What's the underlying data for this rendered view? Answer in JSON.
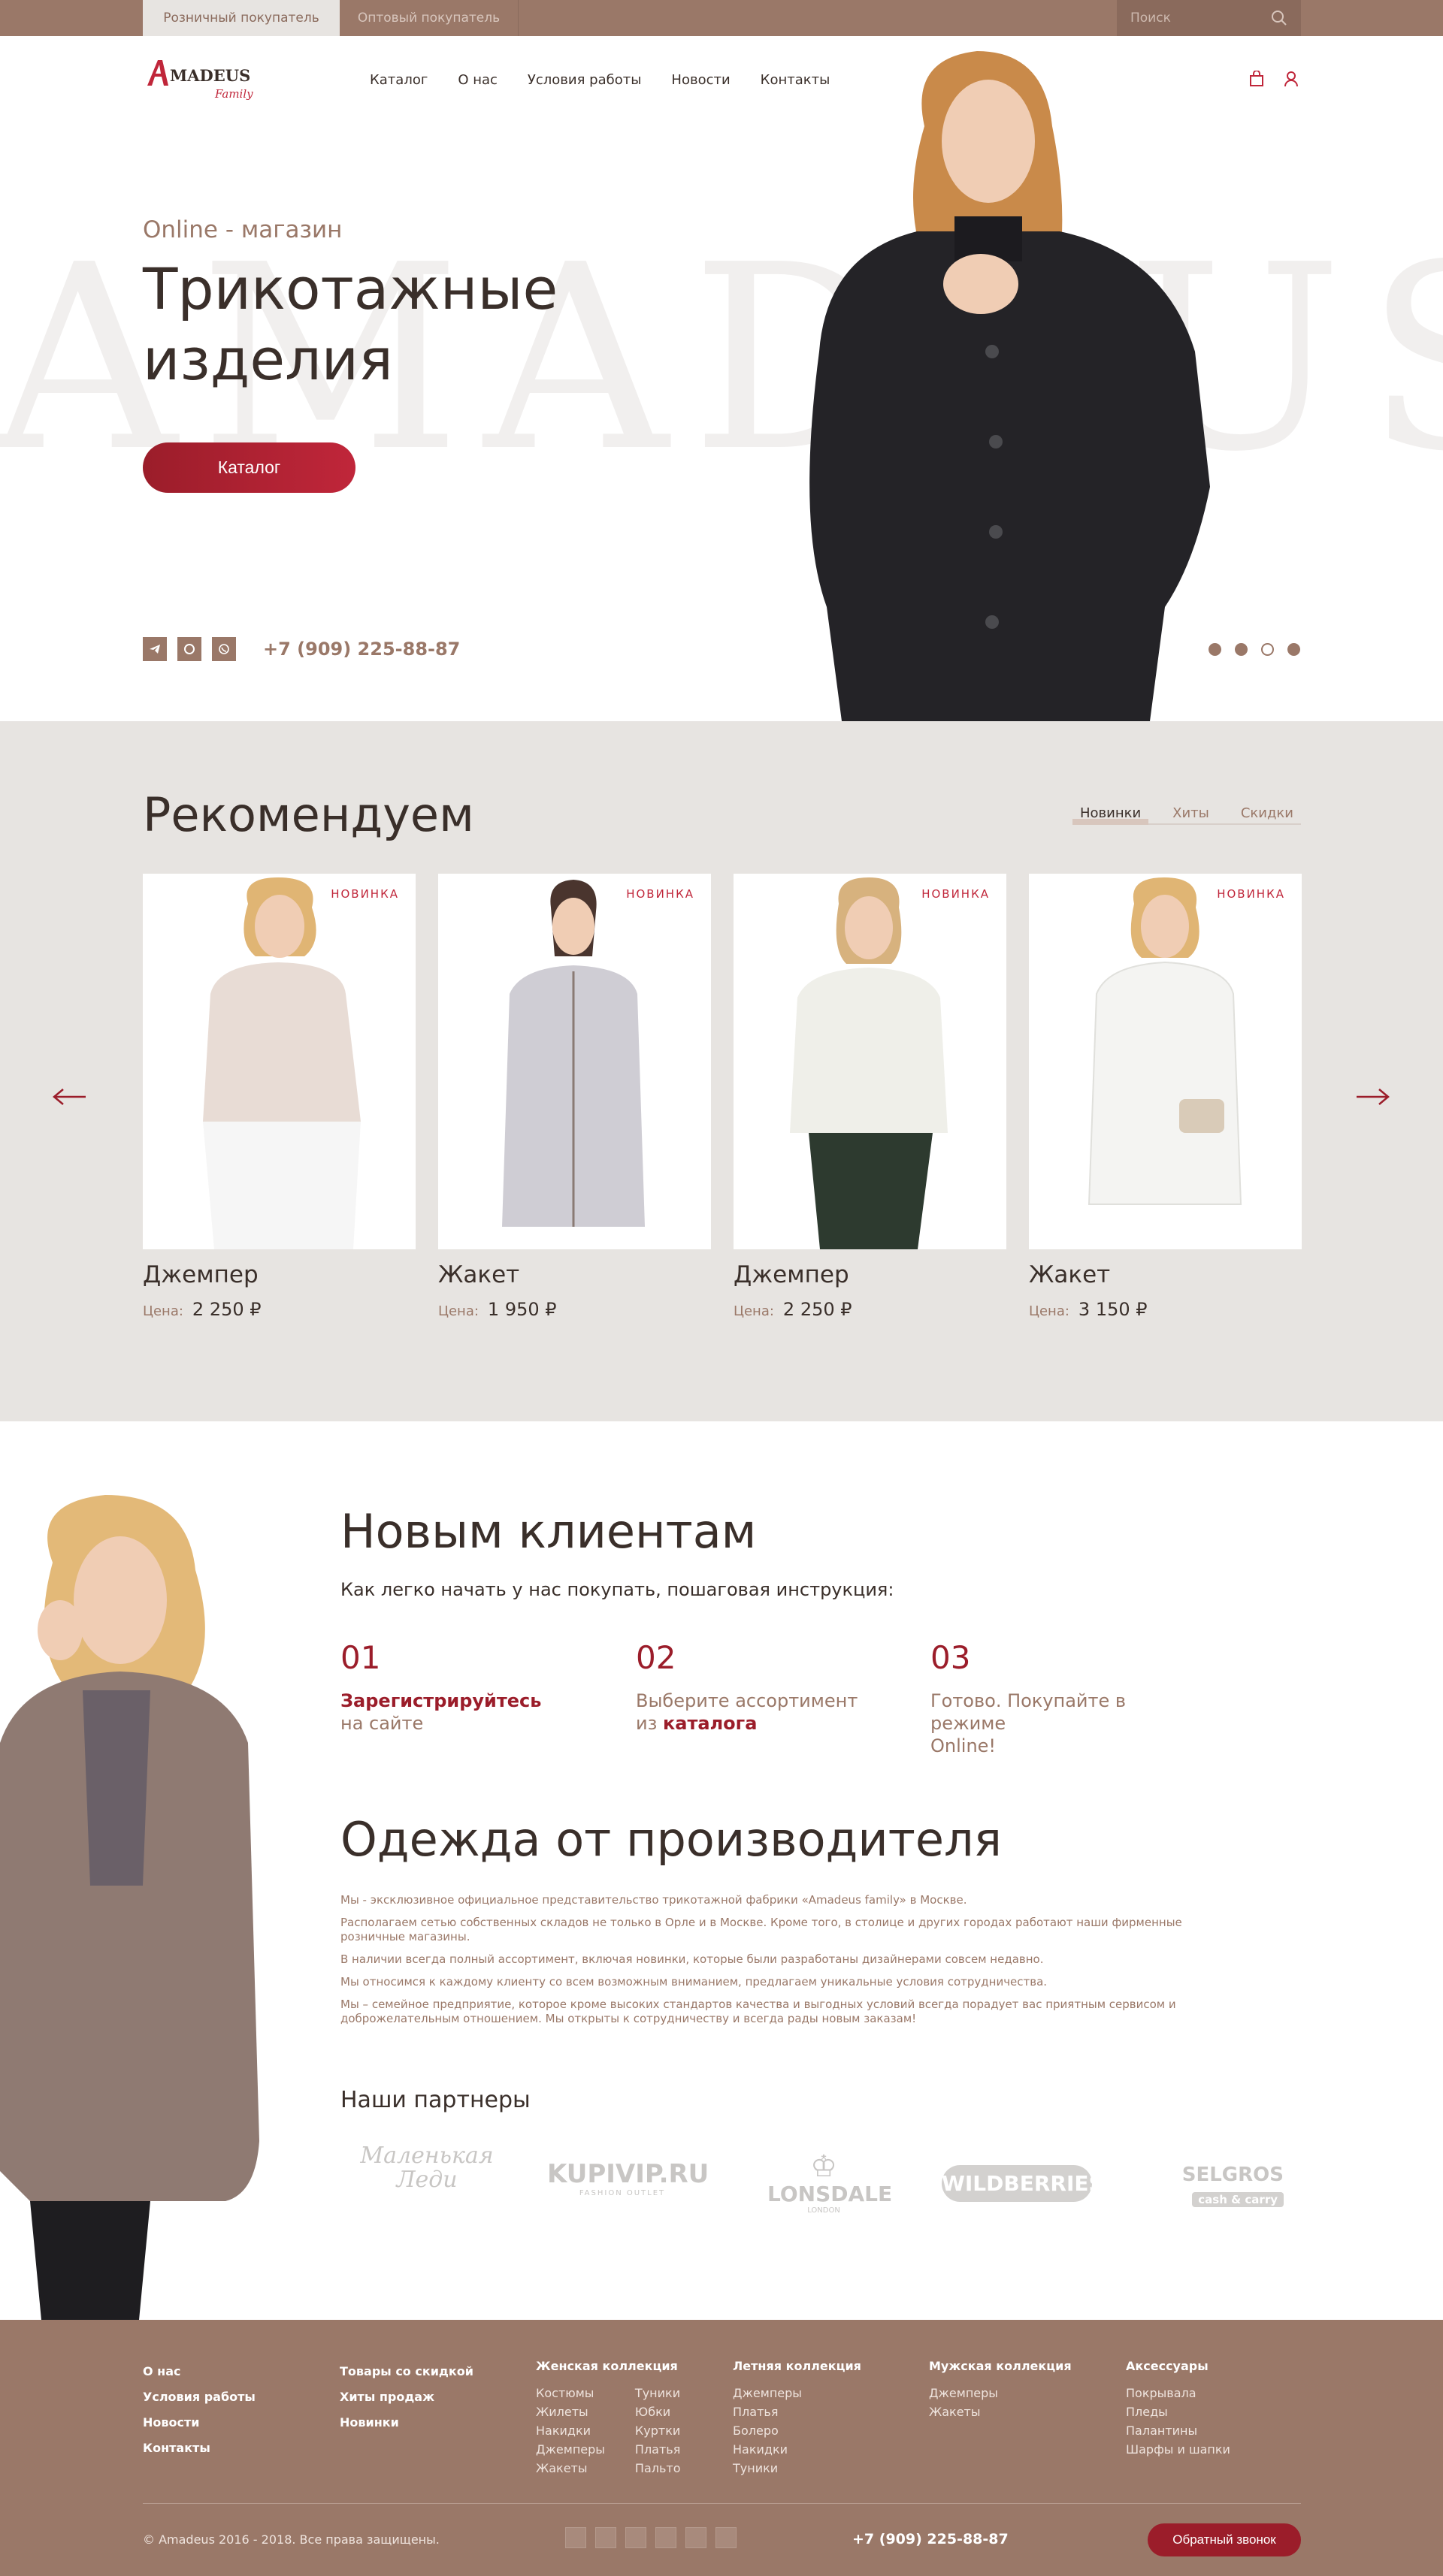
{
  "topbar": {
    "retail": "Розничный покупатель",
    "wholesale": "Оптовый покупатель",
    "search_placeholder": "Поиск"
  },
  "header": {
    "logo": "Amadeus",
    "logo_sub": "Family",
    "nav": [
      "Каталог",
      "О нас",
      "Условия работы",
      "Новости",
      "Контакты"
    ]
  },
  "hero": {
    "bg_word": "AMADEUS",
    "subtitle": "Online - магазин",
    "title_line1": "Трикотажные",
    "title_line2": "изделия",
    "button": "Каталог",
    "phone": "+7 (909) 225-88-87",
    "slides": {
      "count": 4,
      "active": 3
    }
  },
  "recommend": {
    "title": "Рекомендуем",
    "tabs": [
      "Новинки",
      "Хиты",
      "Скидки"
    ],
    "price_label": "Цена:",
    "products": [
      {
        "badge": "НОВИНКА",
        "name": "Джемпер",
        "price": "2 250 ₽",
        "color": "#e8dcd5"
      },
      {
        "badge": "НОВИНКА",
        "name": "Жакет",
        "price": "1 950 ₽",
        "color": "#cfcdd4"
      },
      {
        "badge": "НОВИНКА",
        "name": "Джемпер",
        "price": "2 250 ₽",
        "color": "#efefe9"
      },
      {
        "badge": "НОВИНКА",
        "name": "Жакет",
        "price": "3 150 ₽",
        "color": "#f4f4f2"
      }
    ]
  },
  "clients": {
    "title": "Новым клиентам",
    "subtitle": "Как легко начать у нас покупать, пошаговая инструкция:",
    "steps": [
      {
        "num": "01",
        "bold": "Зарегистрируйтесь",
        "rest": "на сайте"
      },
      {
        "num": "02",
        "pre": "Выберите ассортимент",
        "pre2": "из ",
        "bold": "каталога"
      },
      {
        "num": "03",
        "text1": "Готово. Покупайте в режиме",
        "text2": "Online!"
      }
    ]
  },
  "producer": {
    "title": "Одежда от производителя",
    "paragraphs": [
      "Мы - эксклюзивное официальное представительство трикотажной фабрики «Amadeus family» в Москве.",
      "Располагаем сетью собственных складов не только в Орле и в Москве. Кроме того, в столице и других городах работают наши фирменные розничные магазины.",
      "В наличии всегда полный ассортимент, включая новинки, которые были разработаны дизайнерами совсем недавно.",
      "Мы относимся к каждому клиенту со всем возможным вниманием, предлагаем уникальные условия сотрудничества.",
      "Мы – семейное предприятие, которое кроме высоких стандартов качества и выгодных условий всегда порадует вас приятным сервисом и доброжелательным отношением. Мы открыты к сотрудничеству и всегда рады новым заказам!"
    ]
  },
  "partners": {
    "title": "Наши партнеры",
    "logos": [
      {
        "name": "Маленькая Леди",
        "line1": "Маленькая",
        "line2": "Леди"
      },
      {
        "name": "KUPIVIP.RU",
        "line1": "KUPIVIP.RU",
        "small": "FASHION OUTLET"
      },
      {
        "name": "LONSDALE",
        "line1": "LONSDALE",
        "small": "LONDON"
      },
      {
        "name": "WILDBERRIES",
        "line1": "WILDBERRIES"
      },
      {
        "name": "SELGROS",
        "line1": "SELGROS",
        "small": "cash & carry"
      }
    ]
  },
  "footer": {
    "col1": [
      "О нас",
      "Условия работы",
      "Новости",
      "Контакты"
    ],
    "col2": [
      "Товары со скидкой",
      "Хиты продаж",
      "Новинки"
    ],
    "women": {
      "title": "Женская коллекция",
      "a": [
        "Костюмы",
        "Жилеты",
        "Накидки",
        "Джемперы",
        "Жакеты"
      ],
      "b": [
        "Туники",
        "Юбки",
        "Куртки",
        "Платья",
        "Пальто"
      ]
    },
    "summer": {
      "title": "Летняя коллекция",
      "items": [
        "Джемперы",
        "Платья",
        "Болеро",
        "Накидки",
        "Туники"
      ]
    },
    "men": {
      "title": "Мужская коллекция",
      "items": [
        "Джемперы",
        "Жакеты"
      ]
    },
    "acc": {
      "title": "Аксессуары",
      "items": [
        "Покрывала",
        "Пледы",
        "Палантины",
        "Шарфы и шапки"
      ]
    },
    "copyright": "© Amadeus 2016 - 2018. Все права защищены.",
    "phone": "+7 (909) 225-88-87",
    "callback": "Обратный звонок"
  },
  "colors": {
    "brown": "#9a7868",
    "red": "#9b1d2a",
    "beige": "#e7e4e1"
  }
}
